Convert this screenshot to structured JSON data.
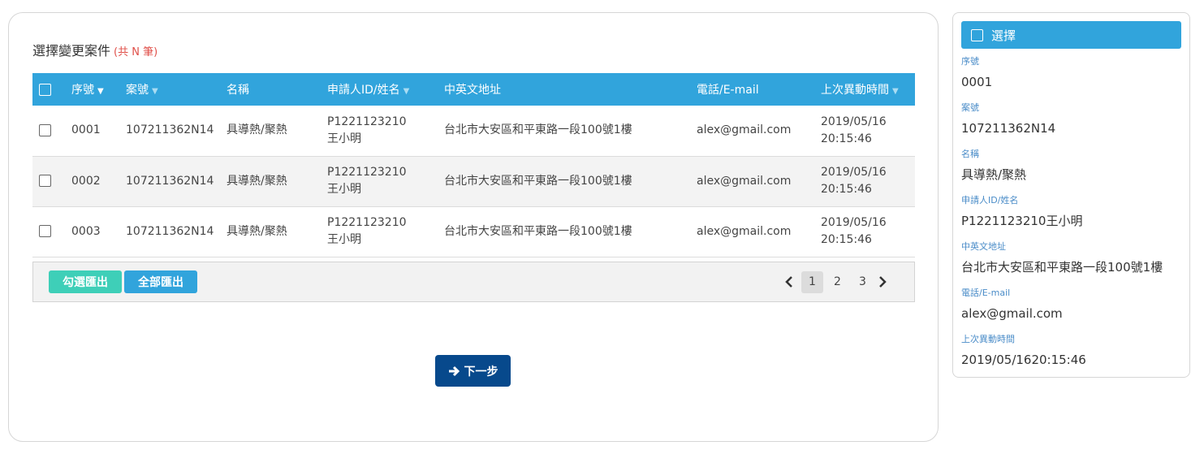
{
  "main": {
    "title": "選擇變更案件",
    "count_label": "(共 N 筆)",
    "columns": [
      "序號",
      "案號",
      "名稱",
      "申請人ID/姓名",
      "中英文地址",
      "電話/E-mail",
      "上次異動時間"
    ],
    "rows": [
      {
        "seq": "0001",
        "case_no": "107211362N14",
        "name": "具導熱/聚熱",
        "applicant_id": "P1221123210",
        "applicant_name": "王小明",
        "address": "台北市大安區和平東路一段100號1樓",
        "contact": "alex@gmail.com",
        "date": "2019/05/16",
        "time": "20:15:46"
      },
      {
        "seq": "0002",
        "case_no": "107211362N14",
        "name": "具導熱/聚熱",
        "applicant_id": "P1221123210",
        "applicant_name": "王小明",
        "address": "台北市大安區和平東路一段100號1樓",
        "contact": "alex@gmail.com",
        "date": "2019/05/16",
        "time": "20:15:46"
      },
      {
        "seq": "0003",
        "case_no": "107211362N14",
        "name": "具導熱/聚熱",
        "applicant_id": "P1221123210",
        "applicant_name": "王小明",
        "address": "台北市大安區和平東路一段100號1樓",
        "contact": "alex@gmail.com",
        "date": "2019/05/16",
        "time": "20:15:46"
      }
    ],
    "export_selected_label": "勾選匯出",
    "export_all_label": "全部匯出",
    "pages": [
      "1",
      "2",
      "3"
    ],
    "current_page": "1",
    "next_label": "下一步"
  },
  "side": {
    "header": "選擇",
    "fields": [
      {
        "label": "序號",
        "value": "0001"
      },
      {
        "label": "案號",
        "value": "107211362N14"
      },
      {
        "label": "名稱",
        "value": "具導熱/聚熱"
      },
      {
        "label": "申請人ID/姓名",
        "value": "P1221123210王小明"
      },
      {
        "label": "中英文地址",
        "value": "台北市大安區和平東路一段100號1樓"
      },
      {
        "label": "電話/E-mail",
        "value": "alex@gmail.com"
      },
      {
        "label": "上次異動時間",
        "value": "2019/05/1620:15:46"
      }
    ]
  },
  "colors": {
    "header_blue": "#31a4dc",
    "teal_button": "#3ecfb8",
    "next_button": "#07498c",
    "count_red": "#e0504a",
    "side_label_blue": "#4a8cc8"
  },
  "icons": [
    "checkbox-icon",
    "sort-down-icon",
    "chevron-left-icon",
    "chevron-right-icon",
    "arrow-right-icon"
  ]
}
